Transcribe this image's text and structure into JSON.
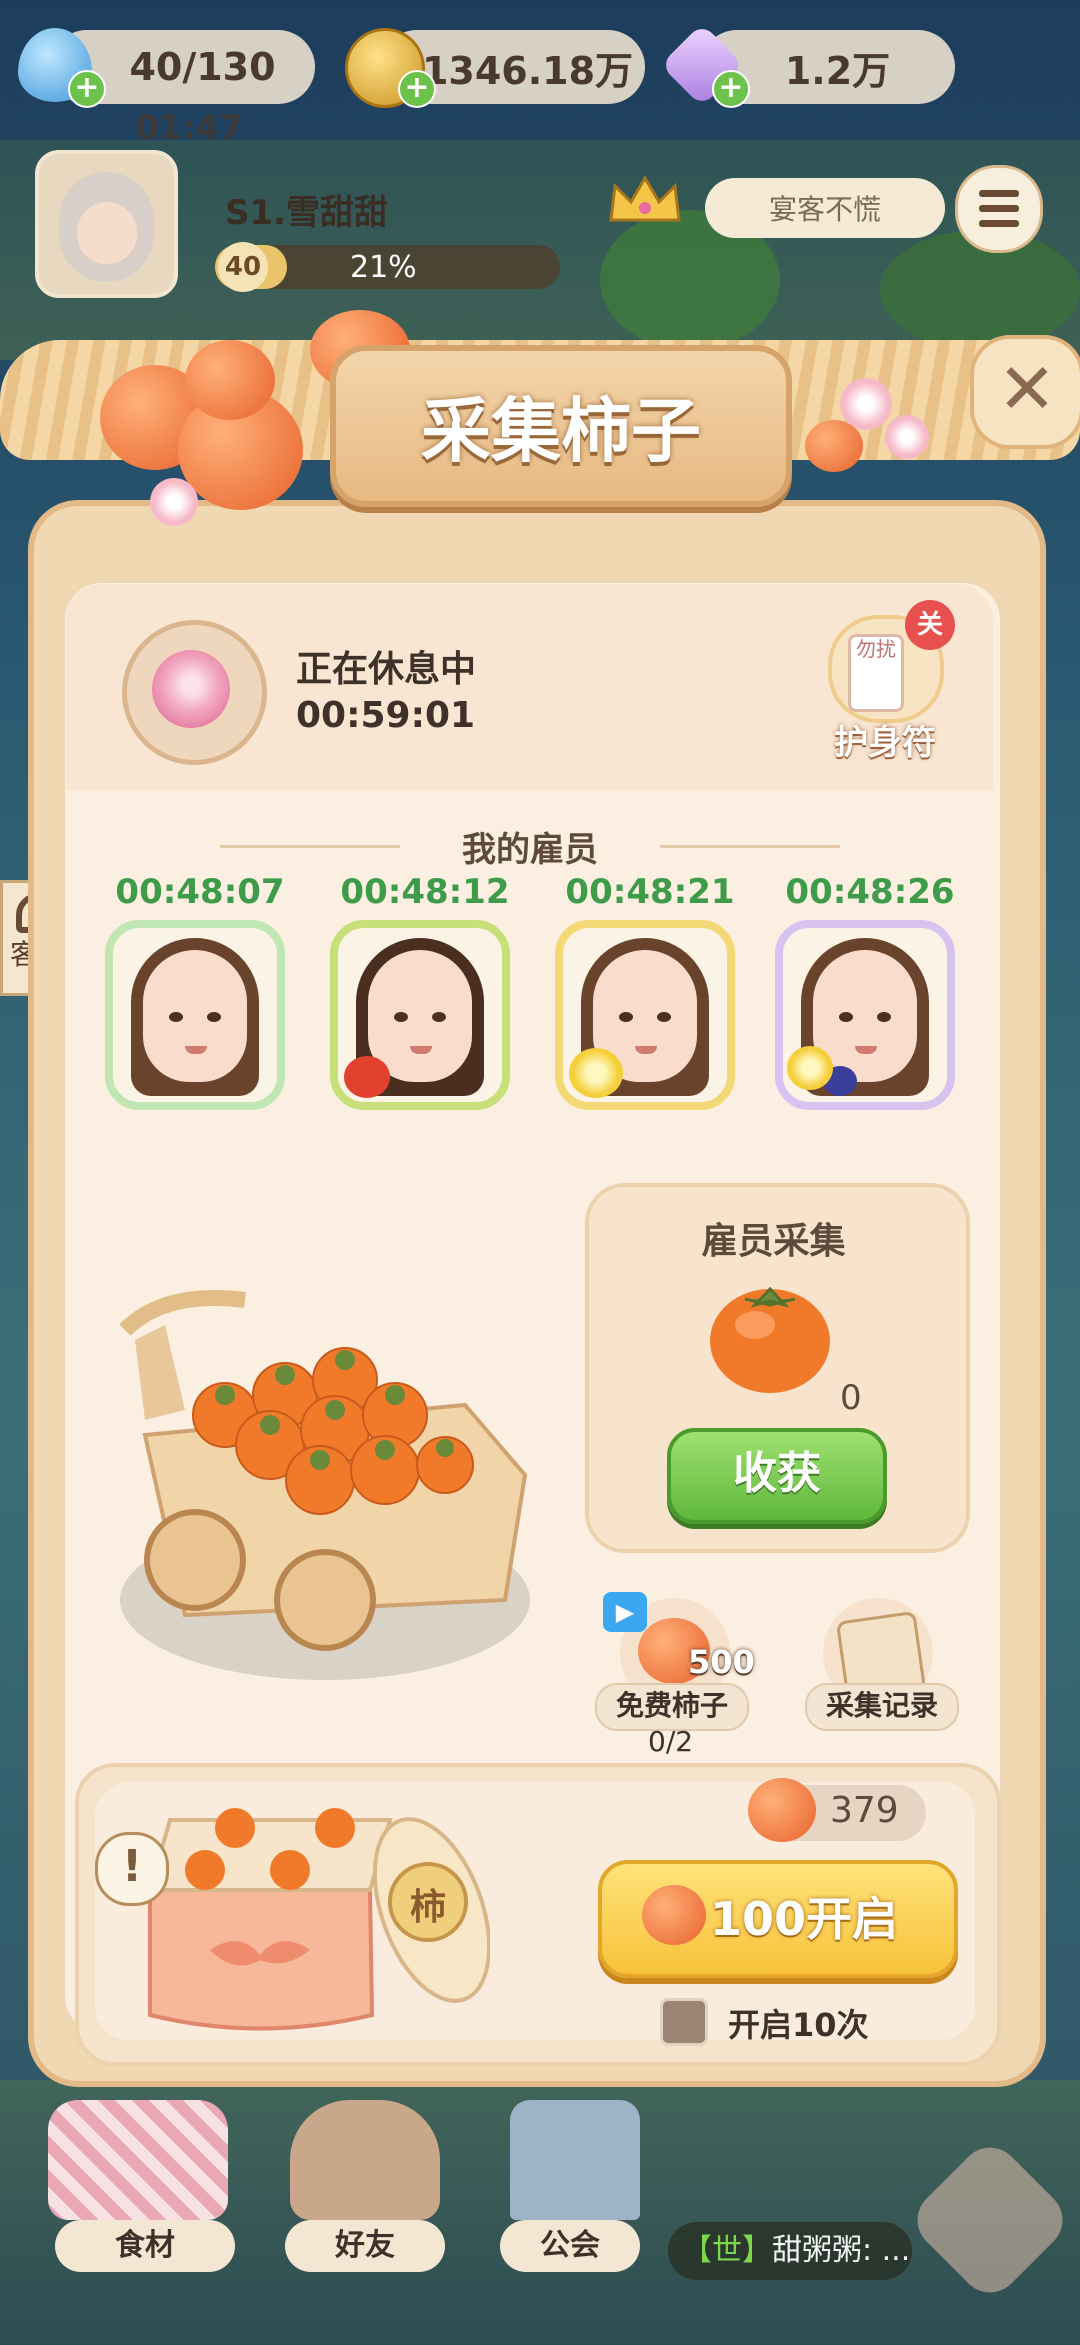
{
  "resources": {
    "water": "40/130",
    "water_timer": "01:47",
    "gold": "1346.18万",
    "gems": "1.2万"
  },
  "player": {
    "name": "S1.雪甜甜",
    "level": "40",
    "progress_text": "21%",
    "progress": 0.21,
    "guest_label": "宴客不慌"
  },
  "side": {
    "customer_service": "客服"
  },
  "popup": {
    "title": "采集柿子",
    "status_label": "正在休息中",
    "status_timer": "00:59:01",
    "amulet_label": "护身符",
    "amulet_toggle": "关",
    "amulet_tag": "勿扰",
    "employees_title": "我的雇员",
    "employees": [
      {
        "timer": "00:48:07",
        "frame": "green"
      },
      {
        "timer": "00:48:12",
        "frame": "lime"
      },
      {
        "timer": "00:48:21",
        "frame": "yellow"
      },
      {
        "timer": "00:48:26",
        "frame": "purple"
      }
    ],
    "harvest": {
      "title": "雇员采集",
      "count": "0",
      "button": "收获"
    },
    "free_persimmon": {
      "label": "免费柿子",
      "amount": "500",
      "progress": "0/2"
    },
    "records": {
      "label": "采集记录"
    },
    "gift": {
      "box_char": "柿",
      "owned": "379",
      "open_button": "100开启",
      "open_ten_label": "开启10次"
    }
  },
  "bottom_nav": {
    "food": "食材",
    "friends": "好友",
    "guild": "公会",
    "chat_channel": "【世】",
    "chat_text": "甜粥粥: ..."
  },
  "colors": {
    "accent_green": "#3e9b4a",
    "harvest_button": "#5fb83c",
    "open_button": "#f7c23a",
    "persimmon": "#f07a2a"
  }
}
